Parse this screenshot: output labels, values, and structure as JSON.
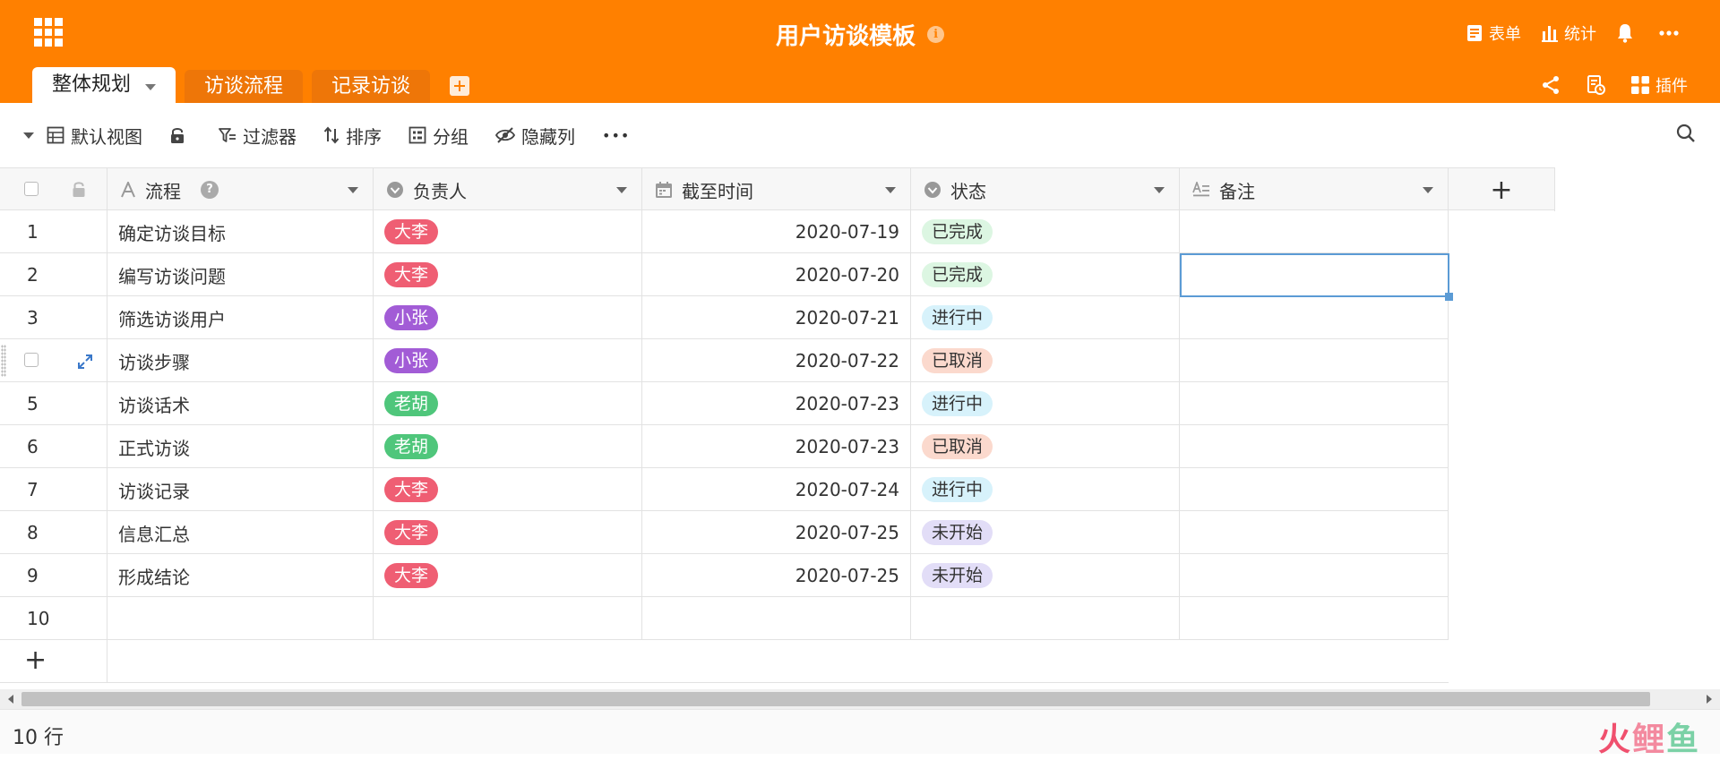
{
  "header": {
    "title": "用户访谈模板",
    "info_icon": "i",
    "form_label": "表单",
    "stats_label": "统计"
  },
  "tabs": [
    {
      "label": "整体规划",
      "active": true
    },
    {
      "label": "访谈流程",
      "active": false
    },
    {
      "label": "记录访谈",
      "active": false
    }
  ],
  "tab_actions": {
    "plugins_label": "插件"
  },
  "toolbar": {
    "view_label": "默认视图",
    "filter_label": "过滤器",
    "sort_label": "排序",
    "group_label": "分组",
    "hide_label": "隐藏列",
    "more_label": "•••"
  },
  "columns": [
    {
      "label": "流程",
      "icon": "text-icon"
    },
    {
      "label": "负责人",
      "icon": "single-select-icon"
    },
    {
      "label": "截至时间",
      "icon": "calendar-icon"
    },
    {
      "label": "状态",
      "icon": "single-select-icon"
    },
    {
      "label": "备注",
      "icon": "long-text-icon"
    }
  ],
  "help_mark": "?",
  "add_symbol": "+",
  "rows": [
    {
      "num": "1",
      "process": "确定访谈目标",
      "owner": "大李",
      "deadline": "2020-07-19",
      "status": "已完成"
    },
    {
      "num": "2",
      "process": "编写访谈问题",
      "owner": "大李",
      "deadline": "2020-07-20",
      "status": "已完成"
    },
    {
      "num": "3",
      "process": "筛选访谈用户",
      "owner": "小张",
      "deadline": "2020-07-21",
      "status": "进行中"
    },
    {
      "num": "4",
      "process": "访谈步骤",
      "owner": "小张",
      "deadline": "2020-07-22",
      "status": "已取消"
    },
    {
      "num": "5",
      "process": "访谈话术",
      "owner": "老胡",
      "deadline": "2020-07-23",
      "status": "进行中"
    },
    {
      "num": "6",
      "process": "正式访谈",
      "owner": "老胡",
      "deadline": "2020-07-23",
      "status": "已取消"
    },
    {
      "num": "7",
      "process": "访谈记录",
      "owner": "大李",
      "deadline": "2020-07-24",
      "status": "进行中"
    },
    {
      "num": "8",
      "process": "信息汇总",
      "owner": "大李",
      "deadline": "2020-07-25",
      "status": "未开始"
    },
    {
      "num": "9",
      "process": "形成结论",
      "owner": "大李",
      "deadline": "2020-07-25",
      "status": "未开始"
    },
    {
      "num": "10",
      "process": "",
      "owner": "",
      "deadline": "",
      "status": ""
    }
  ],
  "hovered_row": 4,
  "selected_cell": {
    "row": 2,
    "column": "备注"
  },
  "owner_colors": {
    "大李": "#ef5e73",
    "小张": "#a25cd6",
    "老胡": "#4fc67b"
  },
  "status_styles": {
    "已完成": {
      "bg": "#dcf6e2",
      "fg": "#333333"
    },
    "进行中": {
      "bg": "#d7f2fb",
      "fg": "#333333"
    },
    "已取消": {
      "bg": "#fbd9cd",
      "fg": "#333333"
    },
    "未开始": {
      "bg": "#e2ddf7",
      "fg": "#333333"
    }
  },
  "footer": {
    "row_count": "10 行",
    "watermark": [
      "火",
      "鲤",
      "鱼"
    ]
  },
  "colors": {
    "brand": "#ff8000",
    "selection": "#5b9bd5"
  }
}
